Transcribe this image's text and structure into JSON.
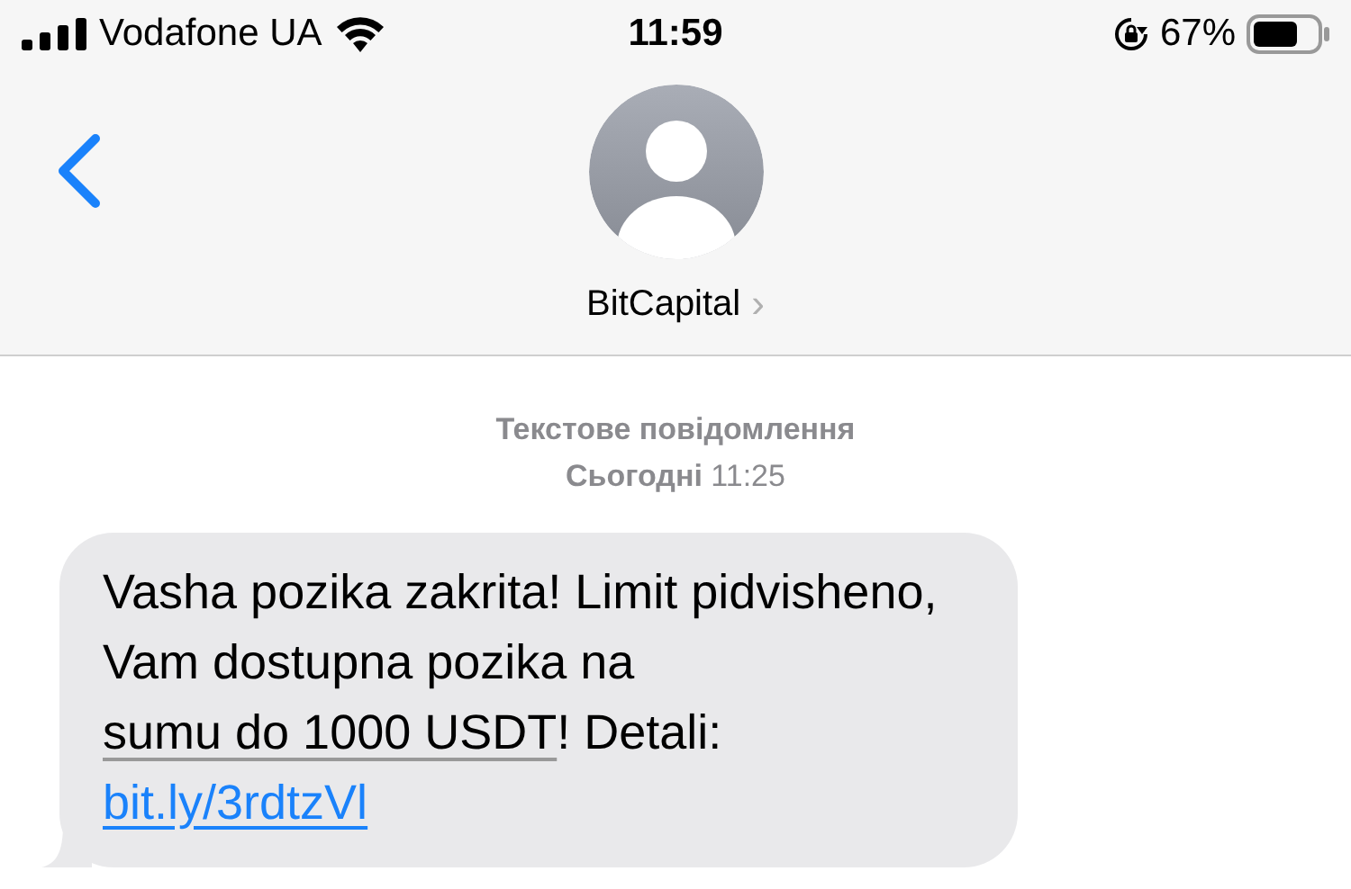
{
  "status_bar": {
    "carrier": "Vodafone UA",
    "time": "11:59",
    "battery": "67%"
  },
  "header": {
    "contact_name": "BitCapital",
    "chevron": "›"
  },
  "thread": {
    "meta_title": "Текстове повідомлення",
    "meta_time": "**Сьогодні** 11:25",
    "message": {
      "parts": [
        {
          "kind": "plain",
          "text": "Vasha pozika zakrita! Limit pidvisheno, Vam dostupna pozika na "
        },
        {
          "kind": "detected",
          "text": "sumu do 1000 USDT"
        },
        {
          "kind": "plain",
          "text": "! Detali: "
        },
        {
          "kind": "link",
          "text": "bit.ly/3rdtzVl"
        }
      ]
    }
  }
}
